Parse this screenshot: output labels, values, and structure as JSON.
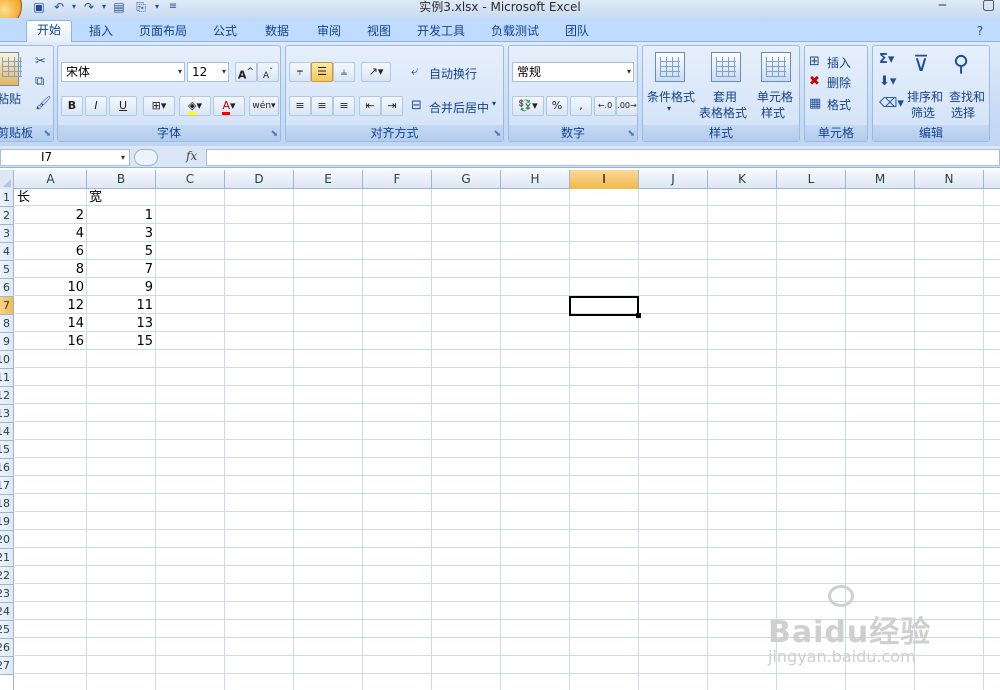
{
  "title": "实例3.xlsx - Microsoft Excel",
  "quick_access": [
    "save-icon",
    "undo-icon",
    "redo-icon",
    "print-preview-icon",
    "format-painter-icon",
    "customize-icon"
  ],
  "tabs": [
    {
      "label": "开始",
      "active": true
    },
    {
      "label": "插入"
    },
    {
      "label": "页面布局"
    },
    {
      "label": "公式"
    },
    {
      "label": "数据"
    },
    {
      "label": "审阅"
    },
    {
      "label": "视图"
    },
    {
      "label": "开发工具"
    },
    {
      "label": "负载测试"
    },
    {
      "label": "团队"
    }
  ],
  "ribbon": {
    "clipboard": {
      "label": "剪贴板",
      "paste": "粘贴"
    },
    "font": {
      "label": "字体",
      "name": "宋体",
      "size": "12",
      "bold": "B",
      "italic": "I",
      "underline": "U",
      "grow": "A",
      "shrink": "A",
      "phonetic": "wén"
    },
    "alignment": {
      "label": "对齐方式",
      "wrap": "自动换行",
      "merge": "合并后居中"
    },
    "number": {
      "label": "数字",
      "format": "常规",
      "percent": "%",
      "comma": ",",
      "inc_decimal": ".0→.00",
      "dec_decimal": ".00→.0"
    },
    "styles": {
      "label": "样式",
      "conditional": "条件格式",
      "table_format_1": "套用",
      "table_format_2": "表格格式",
      "cell_style_1": "单元格",
      "cell_style_2": "样式"
    },
    "cells": {
      "label": "单元格",
      "insert": "插入",
      "delete": "删除",
      "format": "格式"
    },
    "editing": {
      "label": "编辑",
      "sort_1": "排序和",
      "sort_2": "筛选",
      "find_1": "查找和",
      "find_2": "选择"
    }
  },
  "formula_bar": {
    "name_box": "I7",
    "fx": "fx",
    "value": ""
  },
  "columns": [
    "A",
    "B",
    "C",
    "D",
    "E",
    "F",
    "G",
    "H",
    "I",
    "J",
    "K",
    "L",
    "M",
    "N"
  ],
  "selected_column": "I",
  "rows": [
    "1",
    "2",
    "3",
    "4",
    "5",
    "6",
    "7",
    "8",
    "9",
    "10",
    "11",
    "12",
    "13",
    "14",
    "15",
    "16",
    "17",
    "18",
    "19",
    "20",
    "21",
    "22",
    "23",
    "24",
    "25",
    "26",
    "27"
  ],
  "selected_row": "7",
  "cells": {
    "A1": "长",
    "B1": "宽",
    "A2": "2",
    "B2": "1",
    "A3": "4",
    "B3": "3",
    "A4": "6",
    "B4": "5",
    "A5": "8",
    "B5": "7",
    "A6": "10",
    "B6": "9",
    "A7": "12",
    "B7": "11",
    "A8": "14",
    "B8": "13",
    "A9": "16",
    "B9": "15"
  },
  "active_cell": "I7",
  "watermark": {
    "brand": "Baidu经验",
    "url": "jingyan.baidu.com"
  }
}
